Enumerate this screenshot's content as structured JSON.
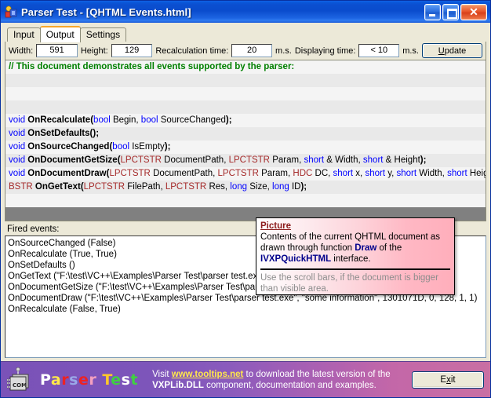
{
  "window": {
    "title": "Parser Test - [QHTML Events.html]",
    "icon": "app-icon",
    "buttons": {
      "minimize": "minimize-icon",
      "maximize": "maximize-icon",
      "close": "close-icon",
      "close_glyph": "✕"
    }
  },
  "tabs": [
    {
      "label": "Input",
      "active": false
    },
    {
      "label": "Output",
      "active": true
    },
    {
      "label": "Settings",
      "active": false
    }
  ],
  "toolbar": {
    "width_label": "Width:",
    "width_value": "591",
    "height_label": "Height:",
    "height_value": "129",
    "recalc_label": "Recalculation time:",
    "recalc_value": "20",
    "recalc_units": "m.s.",
    "display_label": "Displaying time:",
    "display_value": "< 10",
    "display_units": "m.s.",
    "update_button": "Update",
    "update_accel": "U",
    "update_rest": "pdate"
  },
  "document": {
    "comment": "// This document demonstrates all events supported by the parser:",
    "lines": [
      {
        "ret": "void",
        "ret_type": "kw",
        "fn": "OnRecalculate",
        "params": [
          {
            "t": "bool",
            "c": "kw"
          },
          {
            "t": " Begin, ",
            "c": "pl"
          },
          {
            "t": "bool",
            "c": "kw"
          },
          {
            "t": " SourceChanged",
            "c": "pl"
          }
        ]
      },
      {
        "ret": "void",
        "ret_type": "kw",
        "fn": "OnSetDefaults",
        "params": []
      },
      {
        "ret": "void",
        "ret_type": "kw",
        "fn": "OnSourceChanged",
        "params": [
          {
            "t": "bool",
            "c": "kw"
          },
          {
            "t": " IsEmpty",
            "c": "pl"
          }
        ]
      },
      {
        "ret": "void",
        "ret_type": "kw",
        "fn": "OnDocumentGetSize",
        "params": [
          {
            "t": "LPCTSTR",
            "c": "typ"
          },
          {
            "t": " DocumentPath, ",
            "c": "pl"
          },
          {
            "t": "LPCTSTR",
            "c": "typ"
          },
          {
            "t": " Param, ",
            "c": "pl"
          },
          {
            "t": "short",
            "c": "kw"
          },
          {
            "t": " & Width, ",
            "c": "pl"
          },
          {
            "t": "short",
            "c": "kw"
          },
          {
            "t": " & Height",
            "c": "pl"
          }
        ]
      },
      {
        "ret": "void",
        "ret_type": "kw",
        "fn": "OnDocumentDraw",
        "params": [
          {
            "t": "LPCTSTR",
            "c": "typ"
          },
          {
            "t": " DocumentPath, ",
            "c": "pl"
          },
          {
            "t": "LPCTSTR",
            "c": "typ"
          },
          {
            "t": " Param, ",
            "c": "pl"
          },
          {
            "t": "HDC",
            "c": "typ"
          },
          {
            "t": " DC, ",
            "c": "pl"
          },
          {
            "t": "short",
            "c": "kw"
          },
          {
            "t": " x, ",
            "c": "pl"
          },
          {
            "t": "short",
            "c": "kw"
          },
          {
            "t": " y, ",
            "c": "pl"
          },
          {
            "t": "short",
            "c": "kw"
          },
          {
            "t": " Width, ",
            "c": "pl"
          },
          {
            "t": "short",
            "c": "kw"
          },
          {
            "t": " Height",
            "c": "pl"
          }
        ]
      },
      {
        "ret": "BSTR",
        "ret_type": "typ",
        "fn": "OnGetText",
        "params": [
          {
            "t": "LPCTSTR",
            "c": "typ"
          },
          {
            "t": " FilePath, ",
            "c": "pl"
          },
          {
            "t": "LPCTSTR",
            "c": "typ"
          },
          {
            "t": " Res, ",
            "c": "pl"
          },
          {
            "t": "long",
            "c": "kw"
          },
          {
            "t": " Size, ",
            "c": "pl"
          },
          {
            "t": "long",
            "c": "kw"
          },
          {
            "t": " ID",
            "c": "pl"
          }
        ]
      }
    ]
  },
  "tooltip": {
    "title": "Picture",
    "body_1": "Contents of the current QHTML document as drawn through function ",
    "body_draw": "Draw",
    "body_2": " of the ",
    "body_iface": "IVXPQuickHTML",
    "body_3": " interface.",
    "footer": "Use the scroll bars, if the document is bigger than visible area."
  },
  "fired_events": {
    "label": "Fired events:",
    "items": [
      "OnSourceChanged (False)",
      "OnRecalculate (True, True)",
      "OnSetDefaults ()",
      "OnGetText (\"F:\\test\\VC++\\Examples\\Parser Test\\parser test.exe\", \"nothing\", 88, 10)",
      "OnDocumentGetSize (\"F:\\test\\VC++\\Examples\\Parser Test\\parser test.exe\", \"some information\", 1, 1)",
      "OnDocumentDraw (\"F:\\test\\VC++\\Examples\\Parser Test\\parser test.exe\", \"some information\", 1301071D, 0, 128, 1, 1)",
      "OnRecalculate (False, True)"
    ]
  },
  "statusbar": {
    "logo_icon": "com-component-icon",
    "logo_letters": [
      {
        "ch": "P",
        "color": "#ffffff"
      },
      {
        "ch": "a",
        "color": "#ffe84a"
      },
      {
        "ch": "r",
        "color": "#ee2222"
      },
      {
        "ch": "s",
        "color": "#9aa8e8"
      },
      {
        "ch": "e",
        "color": "#ee2222"
      },
      {
        "ch": "r",
        "color": "#f4a0c0"
      },
      {
        "ch": " ",
        "color": "#ffffff"
      },
      {
        "ch": "T",
        "color": "#ffc82a"
      },
      {
        "ch": "e",
        "color": "#3fd23f"
      },
      {
        "ch": "s",
        "color": "#ffffff"
      },
      {
        "ch": "t",
        "color": "#3fd23f"
      }
    ],
    "text_prefix": "Visit ",
    "link": "www.tooltips.net",
    "text_mid": " to download the latest version of the ",
    "bold": "VXPLib.DLL",
    "text_suffix": " component, documentation and examples.",
    "exit_button": "Exit",
    "exit_accel": "E",
    "exit_accel_letter": "x",
    "exit_rest": "it"
  },
  "colors": {
    "titlebar_blue": "#0b4fd0",
    "client_bg": "#ece9d8",
    "render_bg": "#808080",
    "tab_active_accent": "#f7a72a",
    "tooltip_pink": "#ffaebb",
    "status_purple": "#7a52b8",
    "status_pink": "#c96fa3",
    "keyword_blue": "#0000ff",
    "type_brown": "#a52a2a",
    "comment_green": "#008000",
    "tooltip_title_red": "#8b1a1a",
    "tooltip_accent_navy": "#00008b"
  }
}
